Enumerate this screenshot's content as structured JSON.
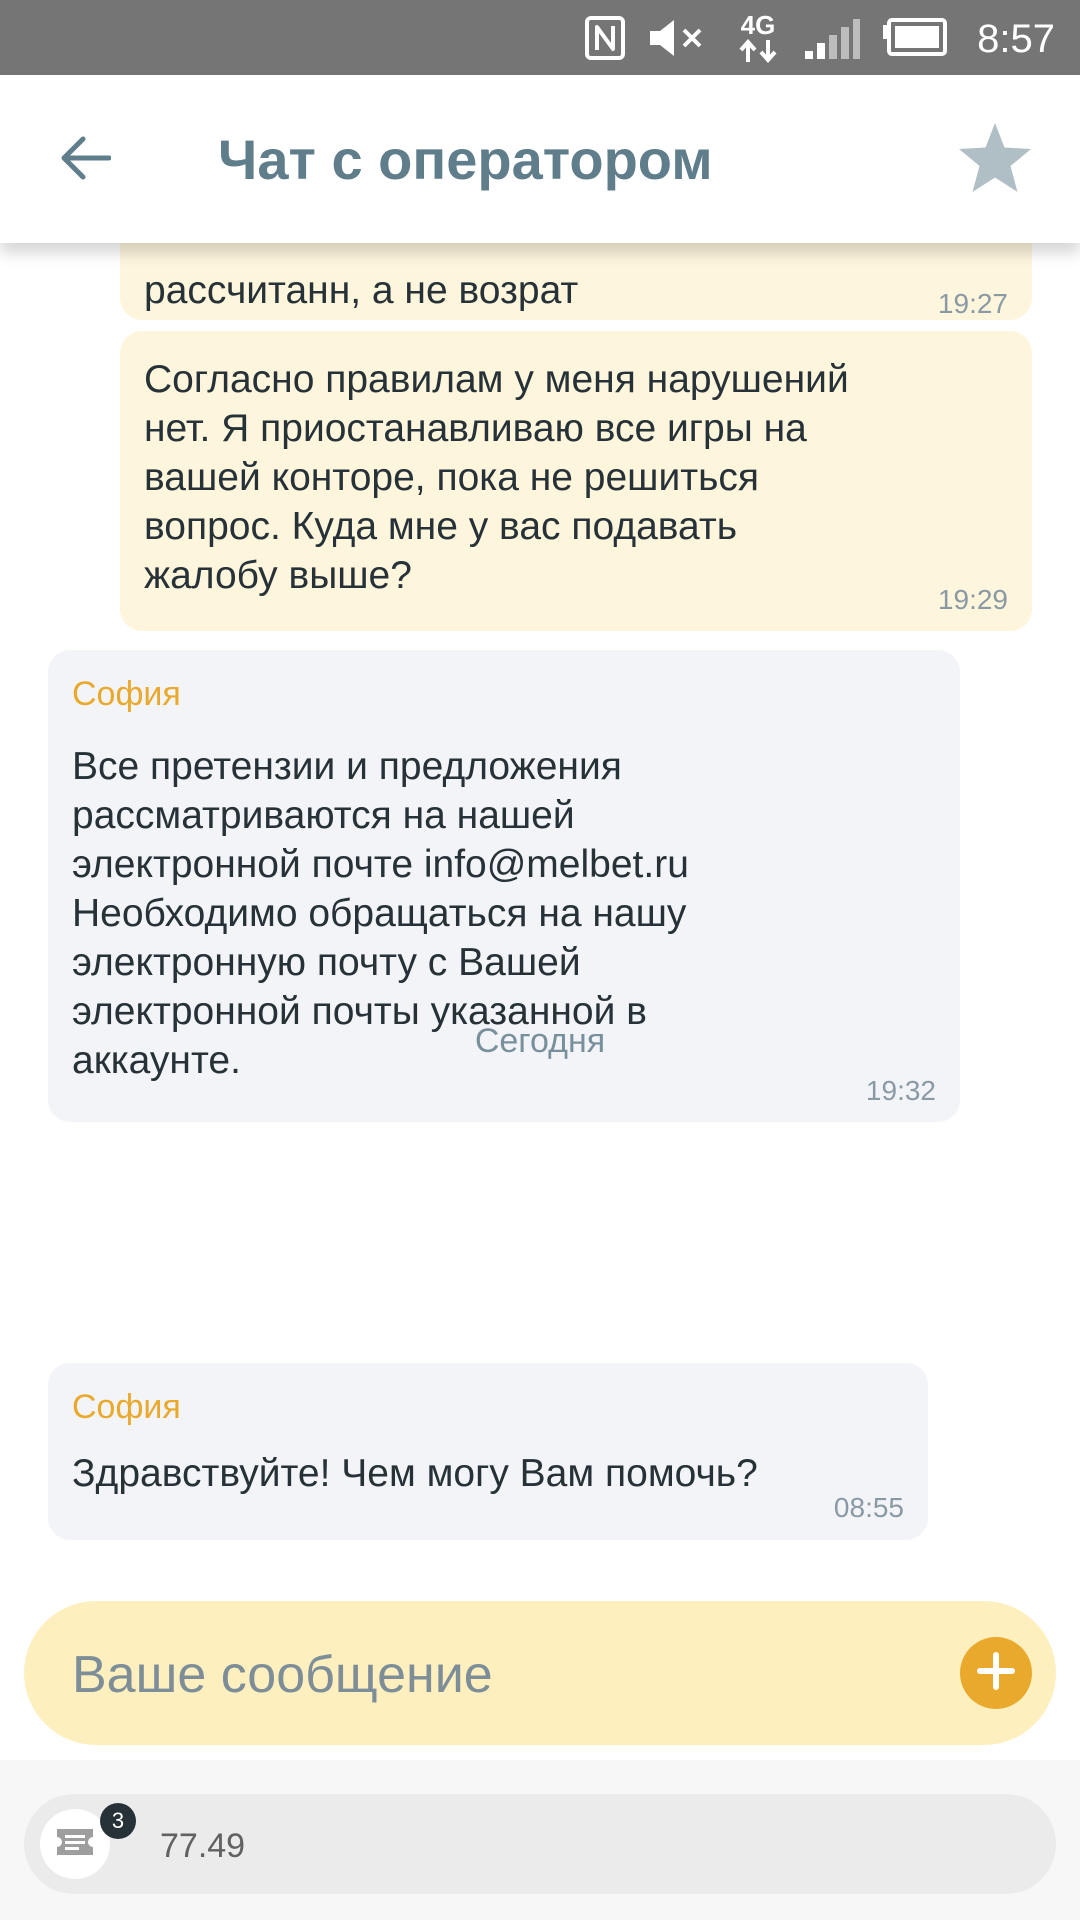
{
  "status_bar": {
    "time": "8:57",
    "network_label": "4G",
    "icons": [
      "nfc-icon",
      "mute-icon",
      "network-4g-icon",
      "signal-icon",
      "battery-icon"
    ]
  },
  "header": {
    "title": "Чат с оператором",
    "back_icon": "arrow-left-icon",
    "star_icon": "star-icon"
  },
  "messages": [
    {
      "from": "user",
      "text": "рассчитанн, а не возрат",
      "time": "19:27"
    },
    {
      "from": "user",
      "text": "Согласно правилам у меня нарушений\nнет. Я приостанавливаю все игры на\nвашей конторе, пока не решиться\nвопрос. Куда мне у вас подавать\nжалобу выше?",
      "time": "19:29"
    },
    {
      "from": "operator",
      "sender": "София",
      "text": "Все претензии и предложения\nрассматриваются на нашей\nэлектронной почте info@melbet.ru\nНеобходимо обращаться на нашу\nэлектронную почту с Вашей\nэлектронной почты указанной в\nаккаунте.",
      "time": "19:32"
    },
    {
      "from": "operator",
      "sender": "София",
      "text": "Здравствуйте! Чем могу Вам помочь?",
      "time": "08:55"
    }
  ],
  "date_separator": "Сегодня",
  "input": {
    "placeholder": "Ваше сообщение",
    "attach_icon": "plus-icon"
  },
  "bottom_bar": {
    "coupon_icon": "coupon-icon",
    "badge_count": "3",
    "value": "77.49"
  },
  "colors": {
    "accent": "#e9a92c",
    "title": "#607d8b",
    "user_bubble": "#fdf5dc",
    "operator_bubble": "#f3f4f8",
    "input_bg": "#fdefbe",
    "status_bar": "#757575"
  }
}
